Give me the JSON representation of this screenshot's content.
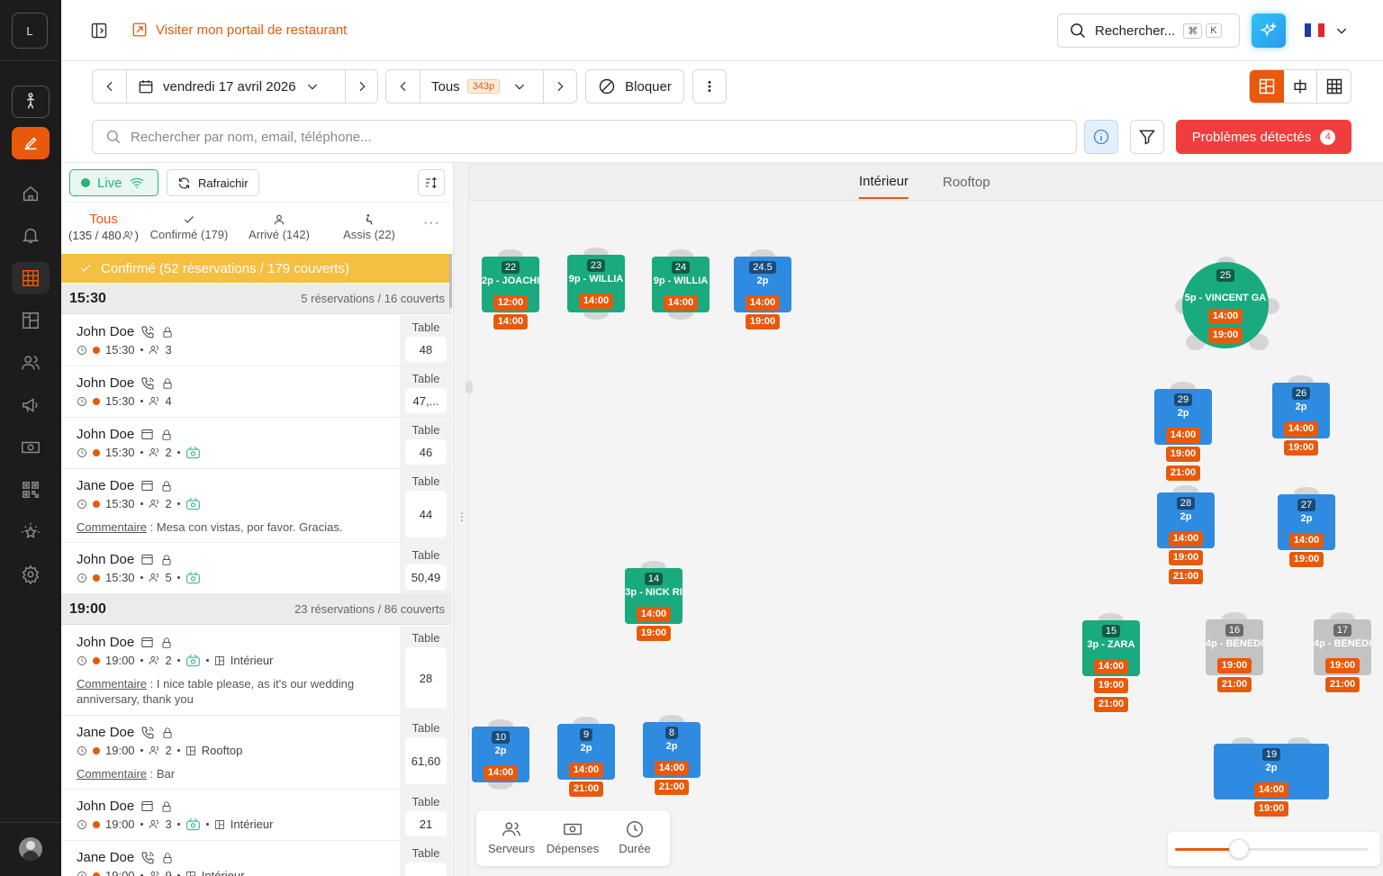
{
  "rail": {
    "logo_letter": "L"
  },
  "topbar": {
    "portal_link": "Visiter mon portail de restaurant",
    "search_placeholder": "Rechercher...",
    "kbd1": "⌘",
    "kbd2": "K"
  },
  "subbar": {
    "date": "vendredi 17 avril 2026",
    "service": "Tous",
    "service_count": "343p",
    "block": "Bloquer"
  },
  "search": {
    "placeholder": "Rechercher par nom, email, téléphone...",
    "problems": "Problèmes détectés",
    "problems_count": "4"
  },
  "panel": {
    "live": "Live",
    "refresh": "Rafraichir",
    "tabs": [
      {
        "label": "Tous",
        "count": "(135 / 480"
      },
      {
        "label": "Confirmé (179)"
      },
      {
        "label": "Arrivé (142)"
      },
      {
        "label": "Assis (22)"
      }
    ],
    "banner": "Confirmé (52 réservations / 179 couverts)",
    "sections": [
      {
        "time": "15:30",
        "info": "5 réservations / 16 couverts"
      },
      {
        "time": "19:00",
        "info": "23 réservations / 86 couverts"
      }
    ],
    "table_label": "Table",
    "comment_label": "Commentaire",
    "reservations": [
      {
        "name": "John Doe",
        "time": "15:30",
        "guests": "3",
        "table": "48"
      },
      {
        "name": "John Doe",
        "time": "15:30",
        "guests": "4",
        "table": "47,..."
      },
      {
        "name": "John Doe",
        "time": "15:30",
        "guests": "2",
        "table": "46"
      },
      {
        "name": "Jane Doe",
        "time": "15:30",
        "guests": "2",
        "table": "44",
        "comment": " : Mesa con vistas, por favor. Gracias."
      },
      {
        "name": "John Doe",
        "time": "15:30",
        "guests": "5",
        "table": "50,49"
      },
      {
        "name": "John Doe",
        "time": "19:00",
        "guests": "2",
        "area": "Intérieur",
        "table": "28",
        "comment": " : I nice table please, as it's our wedding anniversary, thank you"
      },
      {
        "name": "Jane Doe",
        "time": "19:00",
        "guests": "2",
        "area": "Rooftop",
        "table": "61,60",
        "comment": " : Bar"
      },
      {
        "name": "John Doe",
        "time": "19:00",
        "guests": "3",
        "area": "Intérieur",
        "table": "21"
      },
      {
        "name": "Jane Doe",
        "time": "19:00",
        "guests": "9",
        "area": "Intérieur",
        "table": ""
      }
    ]
  },
  "floor": {
    "tabs": [
      "Intérieur",
      "Rooftop"
    ],
    "tools": [
      "Serveurs",
      "Dépenses",
      "Durée"
    ],
    "tables": [
      {
        "num": "22",
        "label": "2p - JOACHI",
        "times": [
          "12:00",
          "14:00"
        ]
      },
      {
        "num": "23",
        "label": "9p - WILLIA",
        "times": [
          "14:00"
        ]
      },
      {
        "num": "24",
        "label": "9p - WILLIA",
        "times": [
          "14:00"
        ]
      },
      {
        "num": "24.5",
        "label": "2p",
        "times": [
          "14:00",
          "19:00"
        ]
      },
      {
        "num": "25",
        "label": "5p - VINCENT GA",
        "times": [
          "14:00",
          "19:00"
        ]
      },
      {
        "num": "29",
        "label": "2p",
        "times": [
          "14:00",
          "19:00",
          "21:00"
        ]
      },
      {
        "num": "26",
        "label": "2p",
        "times": [
          "14:00",
          "19:00"
        ]
      },
      {
        "num": "28",
        "label": "2p",
        "times": [
          "14:00",
          "19:00",
          "21:00"
        ]
      },
      {
        "num": "27",
        "label": "2p",
        "times": [
          "14:00",
          "19:00"
        ]
      },
      {
        "num": "14",
        "label": "3p - NICK RI",
        "times": [
          "14:00",
          "19:00"
        ]
      },
      {
        "num": "15",
        "label": "3p - ZARA",
        "times": [
          "14:00",
          "19:00",
          "21:00"
        ]
      },
      {
        "num": "16",
        "label": "4p - BÉNÉDI",
        "times": [
          "19:00",
          "21:00"
        ]
      },
      {
        "num": "17",
        "label": "4p - BÉNÉDI",
        "times": [
          "19:00",
          "21:00"
        ]
      },
      {
        "num": "10",
        "label": "2p",
        "times": [
          "14:00"
        ]
      },
      {
        "num": "9",
        "label": "2p",
        "times": [
          "14:00",
          "21:00"
        ]
      },
      {
        "num": "8",
        "label": "2p",
        "times": [
          "14:00",
          "21:00"
        ]
      },
      {
        "num": "19",
        "label": "2p",
        "times": [
          "14:00",
          "19:00"
        ]
      }
    ],
    "zoom": 0.33
  },
  "colors": {
    "accent": "#e8590c",
    "available": "#1aaa7f",
    "reserved": "#2f8be0",
    "blocked": "#c3c3c3",
    "danger": "#f03e3e",
    "banner": "#f5bf42"
  }
}
